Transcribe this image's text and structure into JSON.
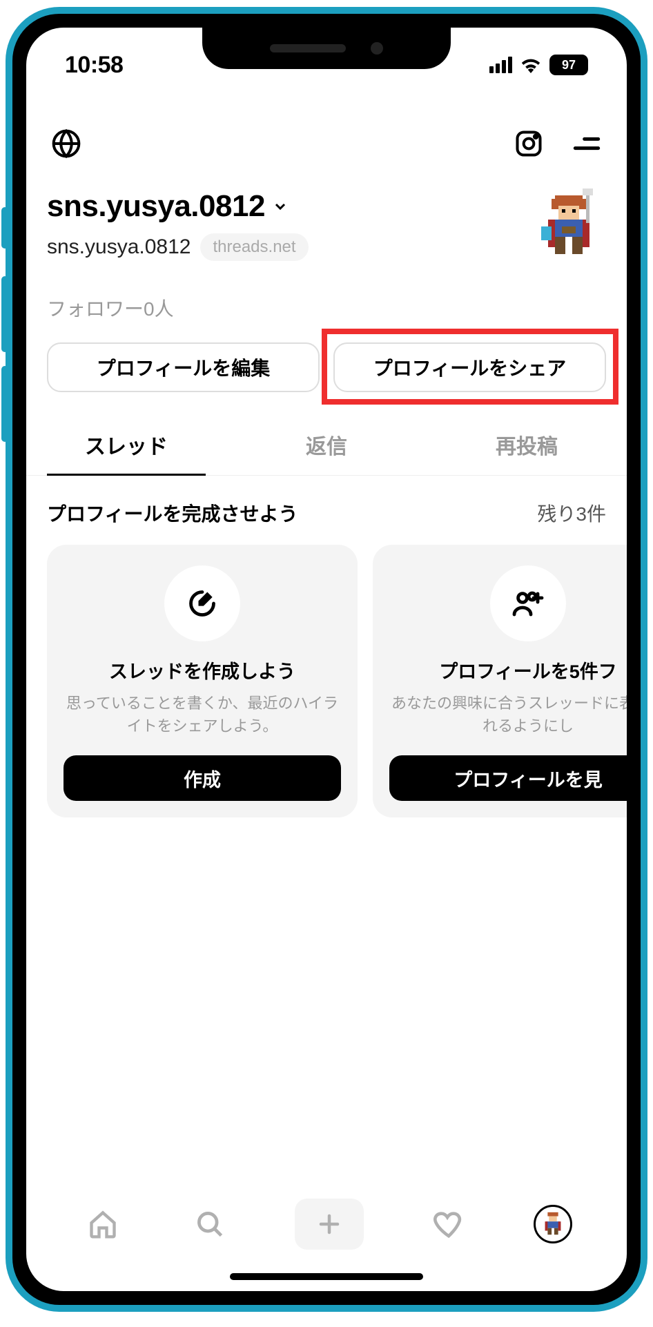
{
  "status": {
    "time": "10:58",
    "battery": "97"
  },
  "profile": {
    "username": "sns.yusya.0812",
    "handle": "sns.yusya.0812",
    "badge": "threads.net",
    "followers": "フォロワー0人"
  },
  "buttons": {
    "edit_profile": "プロフィールを編集",
    "share_profile": "プロフィールをシェア"
  },
  "tabs": [
    {
      "label": "スレッド",
      "active": true
    },
    {
      "label": "返信",
      "active": false
    },
    {
      "label": "再投稿",
      "active": false
    }
  ],
  "complete_section": {
    "title": "プロフィールを完成させよう",
    "remaining": "残り3件"
  },
  "cards": [
    {
      "icon": "edit-icon",
      "title": "スレッドを作成しよう",
      "desc": "思っていることを書くか、最近のハイライトをシェアしよう。",
      "button": "作成"
    },
    {
      "icon": "person-add-icon",
      "title": "プロフィールを5件フ",
      "desc": "あなたの興味に合うスレッードに表示されるようにし",
      "button": "プロフィールを見"
    }
  ]
}
